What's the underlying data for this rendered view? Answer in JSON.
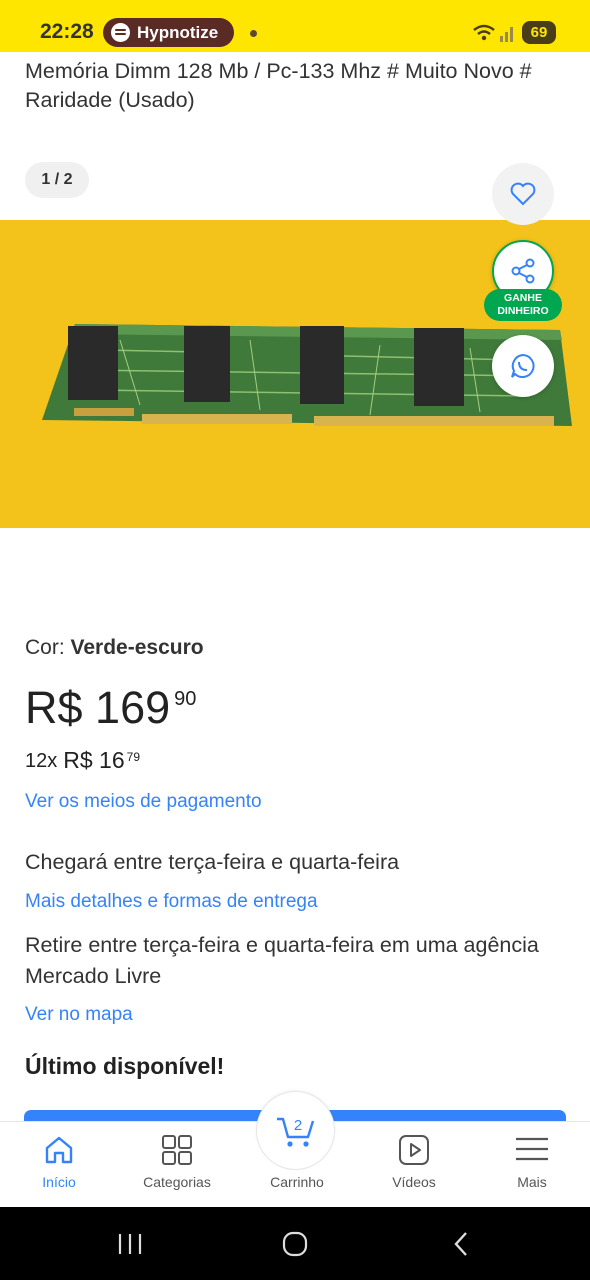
{
  "status_bar": {
    "time": "22:28",
    "media_app": "Hypnotize",
    "battery": "69"
  },
  "product": {
    "title": "Memória Dimm 128 Mb / Pc-133 Mhz # Muito Novo # Raridade (Usado)",
    "image_counter": "1 / 2",
    "color_label": "Cor:",
    "color_value": "Verde-escuro",
    "price_currency": "R$",
    "price_int": "169",
    "price_cents": "90",
    "installments_count": "12x",
    "installments_currency": "R$",
    "installments_int": "16",
    "installments_cents": "79",
    "payment_link": "Ver os meios de pagamento",
    "delivery_text": "Chegará entre terça-feira e quarta-feira",
    "delivery_link": "Mais detalhes e formas de entrega",
    "pickup_text": "Retire entre terça-feira e quarta-feira em uma agência Mercado Livre",
    "map_link": "Ver no mapa",
    "stock_text": "Último disponível!"
  },
  "share": {
    "badge_line1": "GANHE",
    "badge_line2": "DINHEIRO"
  },
  "bottom_nav": {
    "items": [
      {
        "label": "Início",
        "icon": "home-icon"
      },
      {
        "label": "Categorias",
        "icon": "grid-icon"
      },
      {
        "label": "Carrinho",
        "icon": "cart-icon",
        "count": "2"
      },
      {
        "label": "Vídeos",
        "icon": "play-icon"
      },
      {
        "label": "Mais",
        "icon": "menu-icon"
      }
    ]
  },
  "colors": {
    "brand_yellow": "#ffe600",
    "link_blue": "#3483fa",
    "share_green": "#00a650",
    "photo_background": "#f3c21b"
  }
}
